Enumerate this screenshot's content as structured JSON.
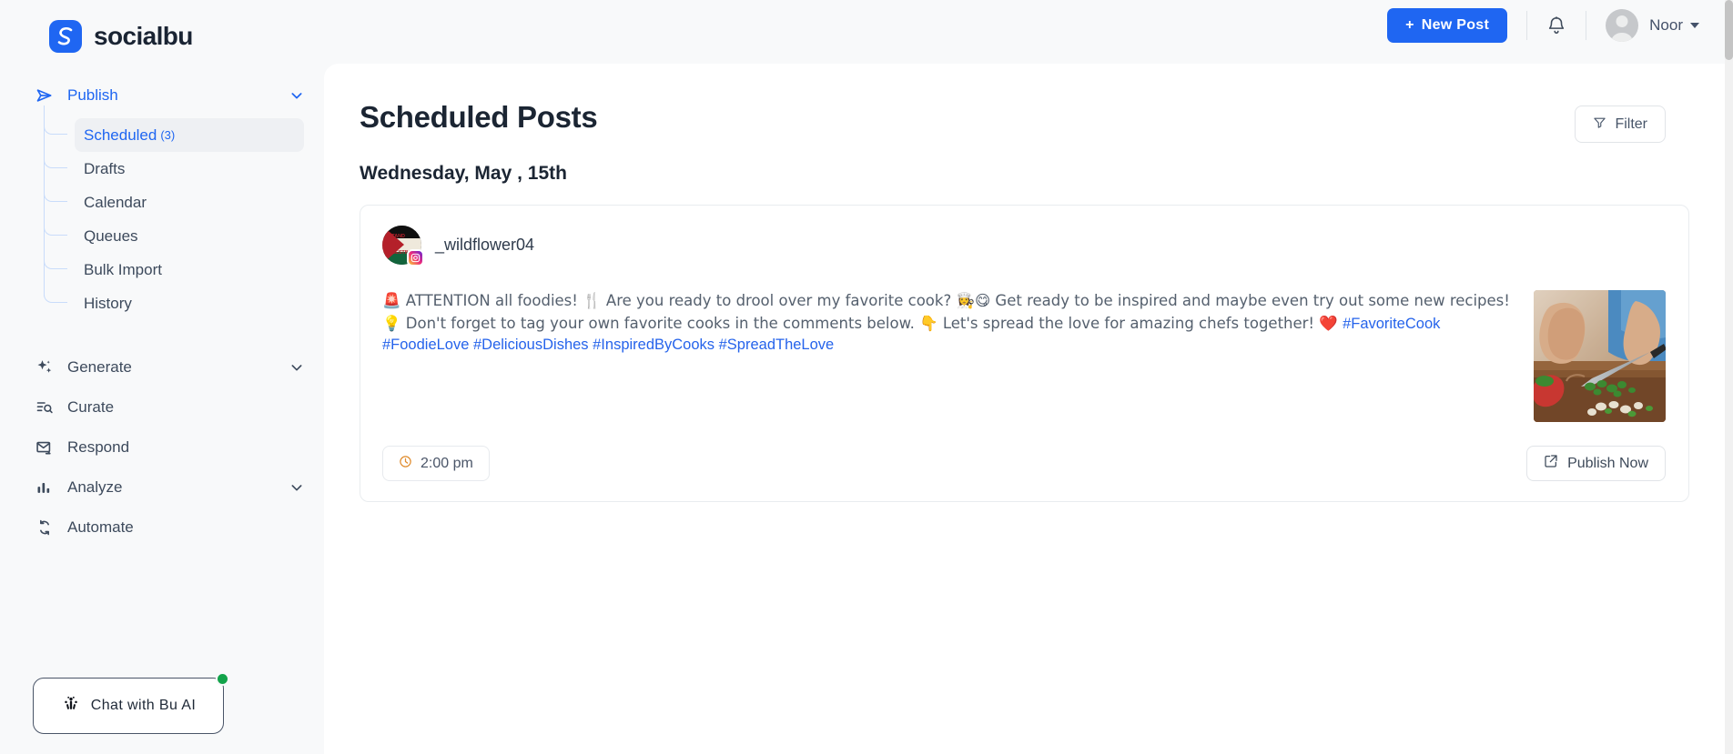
{
  "brand": {
    "name": "socialbu",
    "logo_icon": "socialbu-logo-icon",
    "accent": "#1f66f2"
  },
  "topbar": {
    "new_post_label": "New Post",
    "new_post_plus": "+",
    "bell_icon": "notification-bell-icon",
    "user_name": "Noor",
    "avatar_icon": "user-avatar-icon",
    "caret_icon": "chevron-down-icon"
  },
  "sidebar": {
    "publish": {
      "label": "Publish",
      "icon": "send-paper-plane-icon",
      "chevron": "chevron-down-icon",
      "expanded": true,
      "children": [
        {
          "label": "Scheduled",
          "count": "(3)",
          "selected": true
        },
        {
          "label": "Drafts",
          "count": "",
          "selected": false
        },
        {
          "label": "Calendar",
          "count": "",
          "selected": false
        },
        {
          "label": "Queues",
          "count": "",
          "selected": false
        },
        {
          "label": "Bulk Import",
          "count": "",
          "selected": false
        },
        {
          "label": "History",
          "count": "",
          "selected": false
        }
      ]
    },
    "items": [
      {
        "label": "Generate",
        "icon": "sparkles-icon",
        "chevron": "chevron-down-icon"
      },
      {
        "label": "Curate",
        "icon": "list-search-icon",
        "chevron": ""
      },
      {
        "label": "Respond",
        "icon": "envelope-reply-icon",
        "chevron": ""
      },
      {
        "label": "Analyze",
        "icon": "bar-chart-icon",
        "chevron": "chevron-down-icon"
      },
      {
        "label": "Automate",
        "icon": "refresh-cycle-icon",
        "chevron": ""
      }
    ],
    "chat_widget": {
      "label": "Chat with Bu AI",
      "icon": "bu-ai-icon",
      "status_dot_color": "#12a34a"
    }
  },
  "main": {
    "page_title": "Scheduled Posts",
    "filter": {
      "label": "Filter",
      "icon": "funnel-filter-icon"
    },
    "date_group": "Wednesday, May , 15th",
    "post": {
      "handle": "_wildflower04",
      "avatar_icon": "palestine-flag-avatar-icon",
      "avatar_text_lines": [
        "I STAND",
        "WITH",
        "PALESTINE"
      ],
      "network_badge_icon": "instagram-icon",
      "text_part_1": "🚨 ATTENTION all foodies! 🍴 Are you ready to drool over my favorite cook? 👩‍🍳😋 Get ready to be inspired and maybe even try out some new recipes! 💡 Don't forget to tag your own favorite cooks in the comments below. 👇 Let's spread the love for amazing chefs together! ❤️ ",
      "hashtags": "#FavoriteCook #FoodieLove #DeliciousDishes #InspiredByCooks #SpreadTheLove",
      "thumbnail_icon": "cooking-chopping-vegetables-photo",
      "time": {
        "label": "2:00 pm",
        "icon": "clock-icon",
        "icon_color": "#e08b2c"
      },
      "publish_now": {
        "label": "Publish Now",
        "icon": "share-external-icon"
      }
    }
  }
}
